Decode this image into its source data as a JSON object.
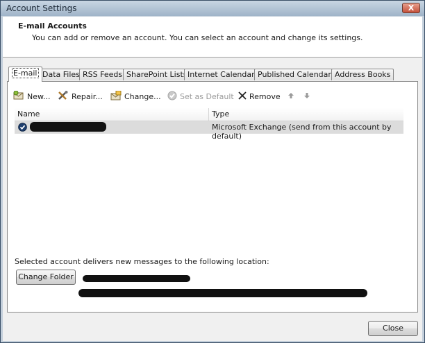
{
  "window": {
    "title": "Account Settings",
    "close_glyph": "X"
  },
  "header": {
    "title": "E-mail Accounts",
    "description": "You can add or remove an account. You can select an account and change its settings."
  },
  "tabs": [
    {
      "label": "E-mail",
      "active": true
    },
    {
      "label": "Data Files"
    },
    {
      "label": "RSS Feeds"
    },
    {
      "label": "SharePoint Lists"
    },
    {
      "label": "Internet Calendars"
    },
    {
      "label": "Published Calendars"
    },
    {
      "label": "Address Books"
    }
  ],
  "toolbar": {
    "new_label": "New...",
    "repair_label": "Repair...",
    "change_label": "Change...",
    "set_default_label": "Set as Default",
    "remove_label": "Remove"
  },
  "accounts_table": {
    "columns": [
      "Name",
      "Type"
    ],
    "rows": [
      {
        "name": "",
        "type": "Microsoft Exchange (send from this account by default)"
      }
    ]
  },
  "location": {
    "label": "Selected account delivers new messages to the following location:",
    "change_folder_label": "Change Folder"
  },
  "footer": {
    "close_label": "Close"
  },
  "colors": {
    "title_bar": "#9fb4c8",
    "dialog_bg": "#f0f0f0",
    "selected_row": "#dcdcdc"
  }
}
